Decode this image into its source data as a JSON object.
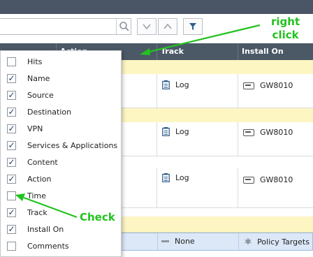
{
  "toolbar": {
    "search_placeholder": "",
    "search_icon": "search-icon",
    "nav_down_icon": "chevron-down-icon",
    "nav_up_icon": "chevron-up-icon",
    "filter_icon": "filter-icon"
  },
  "table": {
    "columns": [
      "Action",
      "Track",
      "Install On"
    ],
    "rows": [
      {
        "track": "Log",
        "install_on": "GW8010"
      },
      {
        "track": "Log",
        "install_on": "GW8010"
      },
      {
        "track": "Log",
        "install_on": "GW8010"
      },
      {
        "track": "None",
        "install_on": "Policy Targets"
      }
    ]
  },
  "column_menu": {
    "items": [
      {
        "label": "Hits",
        "checked": false
      },
      {
        "label": "Name",
        "checked": true
      },
      {
        "label": "Source",
        "checked": true
      },
      {
        "label": "Destination",
        "checked": true
      },
      {
        "label": "VPN",
        "checked": true
      },
      {
        "label": "Services & Applications",
        "checked": true
      },
      {
        "label": "Content",
        "checked": true
      },
      {
        "label": "Action",
        "checked": true
      },
      {
        "label": "Time",
        "checked": false
      },
      {
        "label": "Track",
        "checked": true
      },
      {
        "label": "Install On",
        "checked": true
      },
      {
        "label": "Comments",
        "checked": false
      }
    ]
  },
  "annotations": {
    "right_click_line1": "right",
    "right_click_line2": "click",
    "check": "Check",
    "color": "#22c21f"
  }
}
